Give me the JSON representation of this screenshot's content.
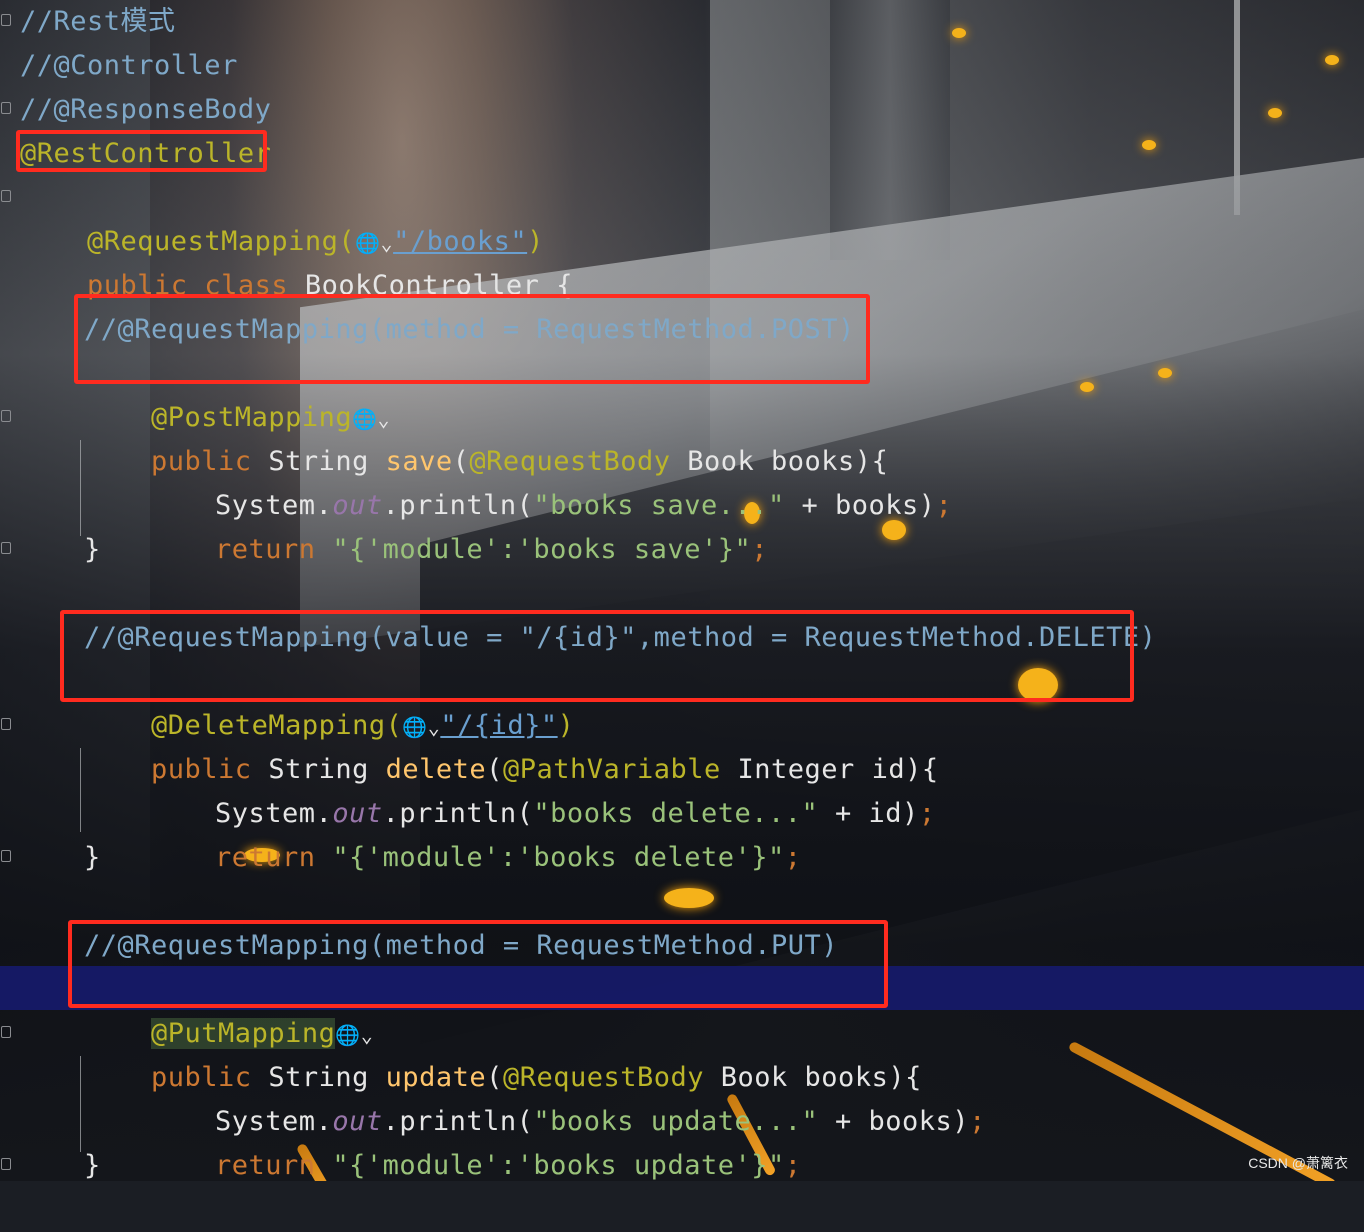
{
  "editor": {
    "language": "Java",
    "lines": {
      "l1": "//Rest模式",
      "l2": "//@Controller",
      "l3": "//@ResponseBody",
      "l4": "@RestController",
      "l5_ann": "@RequestMapping(",
      "l5_path": "\"/books\"",
      "l5_close": ")",
      "l6_kw": "public class",
      "l6_name": " BookController {",
      "l7": "//@RequestMapping(method = RequestMethod.POST)",
      "l8": "@PostMapping",
      "l9_kw": "public",
      "l9_type": " String ",
      "l9_fn": "save",
      "l9_p": "(",
      "l9_ann": "@RequestBody",
      "l9_rest": " Book books){",
      "l10_a": "System.",
      "l10_out": "out",
      "l10_b": ".println(",
      "l10_str": "\"books save...\"",
      "l10_c": " + books)",
      "l10_semi": ";",
      "l11_kw": "return",
      "l11_str": " \"{'module':'books save'}\"",
      "l11_semi": ";",
      "l12": "}",
      "l13": "//@RequestMapping(value = \"/{id}\",method = RequestMethod.DELETE)",
      "l14_ann": "@DeleteMapping(",
      "l14_path": "\"/{id}\"",
      "l14_close": ")",
      "l15_kw": "public",
      "l15_type": " String ",
      "l15_fn": "delete",
      "l15_p": "(",
      "l15_ann": "@PathVariable",
      "l15_rest": " Integer id){",
      "l16_a": "System.",
      "l16_out": "out",
      "l16_b": ".println(",
      "l16_str": "\"books delete...\"",
      "l16_c": " + id)",
      "l16_semi": ";",
      "l17_kw": "return",
      "l17_str": " \"{'module':'books delete'}\"",
      "l17_semi": ";",
      "l18": "}",
      "l19": "//@RequestMapping(method = RequestMethod.PUT)",
      "l20": "@PutMapping",
      "l21_kw": "public",
      "l21_type": " String ",
      "l21_fn": "update",
      "l21_p": "(",
      "l21_ann": "@RequestBody",
      "l21_rest": " Book books){",
      "l22_a": "System.",
      "l22_out": "out",
      "l22_b": ".println(",
      "l22_str": "\"books update...\"",
      "l22_c": " + books)",
      "l22_semi": ";",
      "l23_kw": "return",
      "l23_str": " \"{'module':'books update'}\"",
      "l23_semi": ";",
      "l24": "}"
    },
    "inlay_globe": "🌐⌄"
  },
  "watermark": "CSDN @萧篱衣",
  "colors": {
    "highlight_box": "#ff2b1f",
    "comment": "#7fa8c8",
    "annotation": "#bbb529",
    "keyword": "#cc7832",
    "string": "#6a8759",
    "method": "#ffc66d",
    "current_line": "#161a6e"
  }
}
